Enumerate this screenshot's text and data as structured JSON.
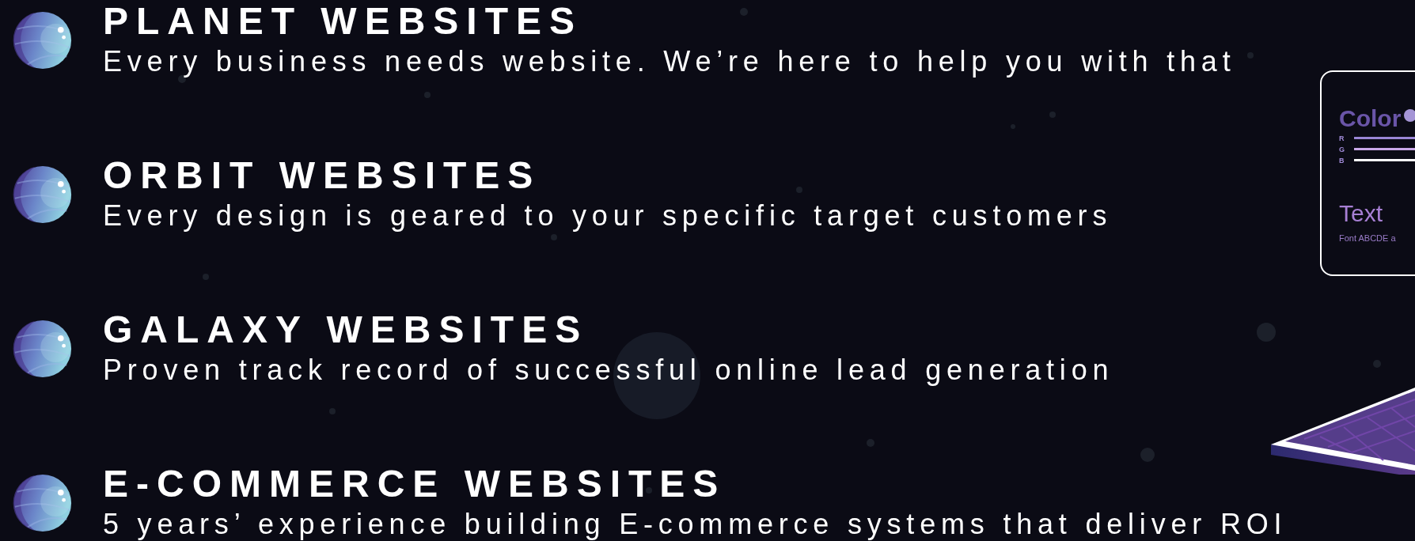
{
  "features": [
    {
      "title": "PLANET WEBSITES",
      "description": "Every business needs website. We’re here to help you with that"
    },
    {
      "title": "ORBIT WEBSITES",
      "description": "Every design is geared to your specific target customers"
    },
    {
      "title": "GALAXY WEBSITES",
      "description": "Proven track record of successful online lead generation"
    },
    {
      "title": "E-COMMERCE WEBSITES",
      "description": "5 years’ experience building E-commerce systems that deliver ROI"
    }
  ],
  "mockup": {
    "color_label": "Color",
    "channels": [
      "R",
      "G",
      "B"
    ],
    "text_label": "Text",
    "font_sample": "Font  ABCDE a"
  }
}
